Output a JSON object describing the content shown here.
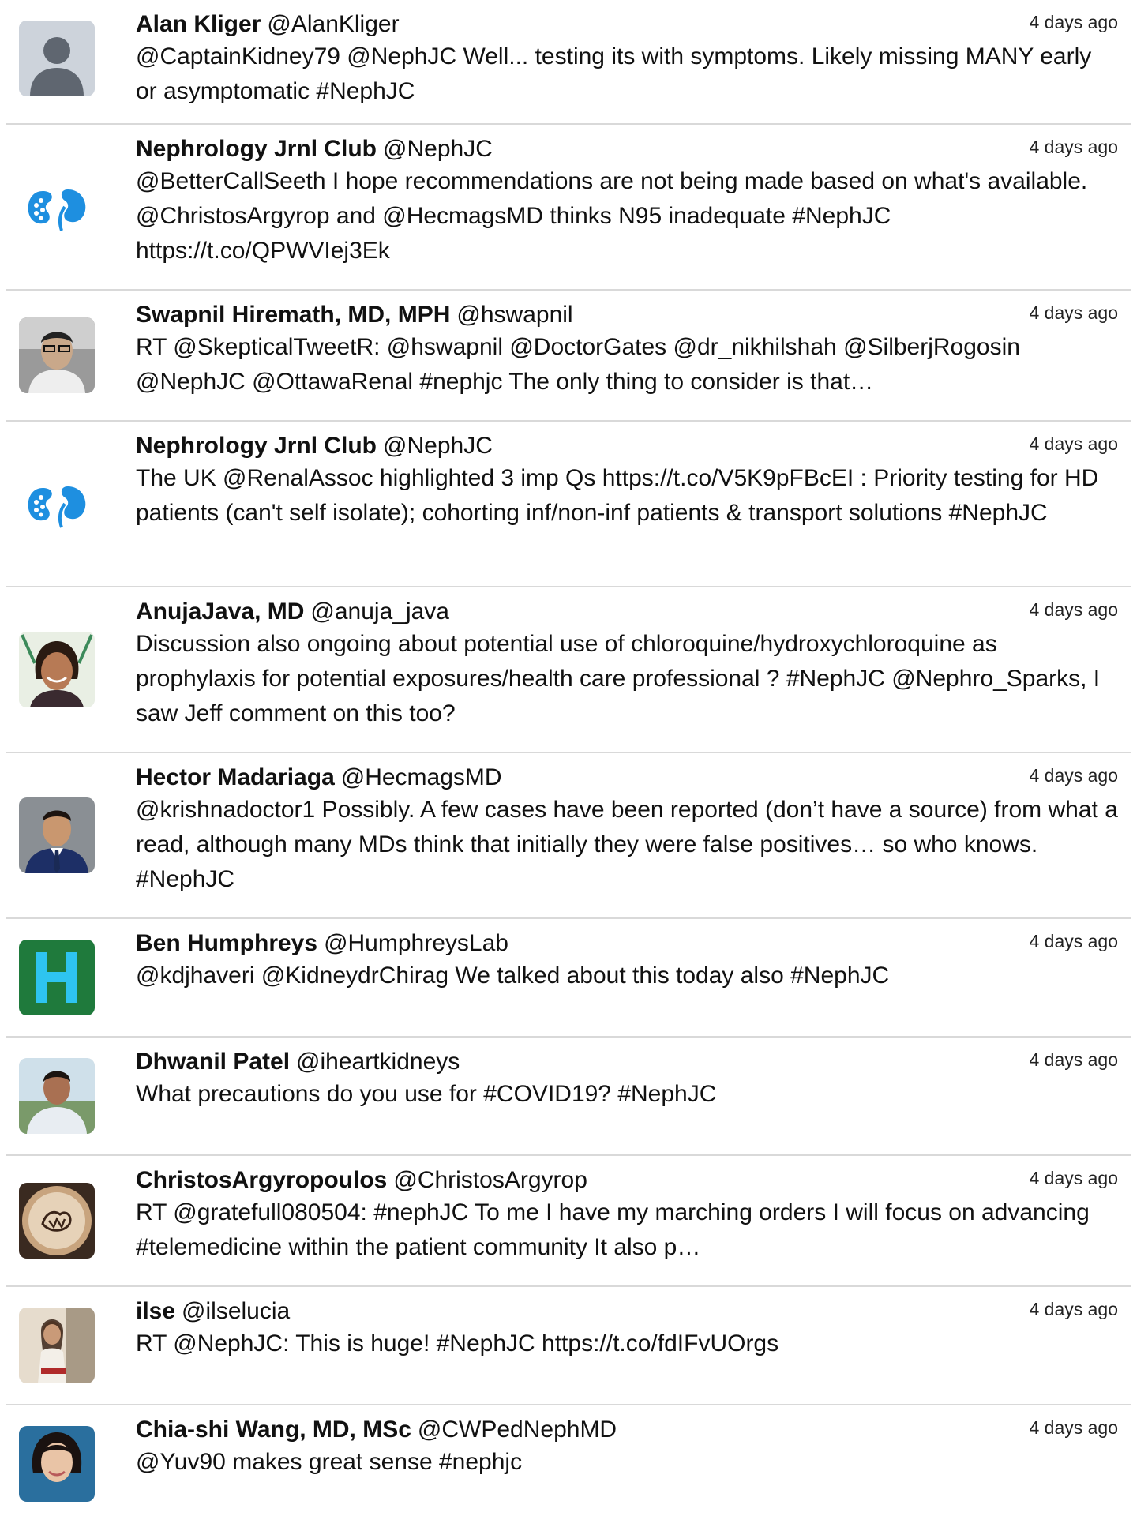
{
  "tweets": [
    {
      "name": "Alan Kliger",
      "handle": "@AlanKliger",
      "time": "4 days ago",
      "text": "@CaptainKidney79 @NephJC Well... testing its with symptoms. Likely missing MANY early or asymptomatic #NephJC",
      "avatar_icon": "default-user-icon"
    },
    {
      "name": "Nephrology Jrnl Club",
      "handle": "@NephJC",
      "time": "4 days ago",
      "text": "@BetterCallSeeth I hope recommendations are not being made based on what's available. @ChristosArgyrop and @HecmagsMD thinks N95 inadequate #NephJC https://t.co/QPWVIej3Ek",
      "avatar_icon": "kidney-logo-icon"
    },
    {
      "name": "Swapnil Hiremath, MD, MPH",
      "handle": "@hswapnil",
      "time": "4 days ago",
      "text": "RT @SkepticalTweetR: @hswapnil @DoctorGates @dr_nikhilshah @SilberjRogosin @NephJC @OttawaRenal #nephjc The only thing to consider is that…",
      "avatar_icon": "profile-photo-icon"
    },
    {
      "name": "Nephrology Jrnl Club",
      "handle": "@NephJC",
      "time": "4 days ago",
      "text": "The UK @RenalAssoc highlighted 3 imp Qs https://t.co/V5K9pFBcEI : Priority testing for HD patients (can't self isolate); cohorting inf/non-inf patients & transport solutions #NephJC",
      "avatar_icon": "kidney-logo-icon"
    },
    {
      "name": "AnujaJava, MD",
      "handle": "@anuja_java",
      "time": "4 days ago",
      "text": "Discussion also ongoing about potential use of chloroquine/hydroxychloroquine as prophylaxis for potential exposures/health care professional ? #NephJC @Nephro_Sparks, I saw Jeff comment on this too?",
      "avatar_icon": "profile-photo-icon"
    },
    {
      "name": "Hector Madariaga",
      "handle": "@HecmagsMD",
      "time": "4 days ago",
      "text": "@krishnadoctor1 Possibly. A few cases have been reported (don’t have a source) from what a read, although many MDs think that initially they were false positives… so who knows. #NephJC",
      "avatar_icon": "profile-photo-icon"
    },
    {
      "name": "Ben Humphreys",
      "handle": "@HumphreysLab",
      "time": "4 days ago",
      "text": "@kdjhaveri @KidneydrChirag We talked about this today also #NephJC",
      "avatar_icon": "letter-h-logo-icon"
    },
    {
      "name": "Dhwanil Patel",
      "handle": "@iheartkidneys",
      "time": "4 days ago",
      "text": "What precautions do you use for #COVID19? #NephJC",
      "avatar_icon": "profile-photo-icon"
    },
    {
      "name": "ChristosArgyropoulos",
      "handle": "@ChristosArgyrop",
      "time": "4 days ago",
      "text": "RT @gratefull080504: #nephJC To me I have my marching orders I will focus on advancing #telemedicine within the patient community It also p…",
      "avatar_icon": "latte-art-icon"
    },
    {
      "name": "ilse",
      "handle": "@ilselucia",
      "time": "4 days ago",
      "text": "RT @NephJC: This is huge! #NephJC https://t.co/fdIFvUOrgs",
      "avatar_icon": "profile-photo-icon"
    },
    {
      "name": "Chia-shi Wang, MD, MSc",
      "handle": "@CWPedNephMD",
      "time": "4 days ago",
      "text": "@Yuv90 makes great sense #nephjc",
      "avatar_icon": "profile-photo-icon"
    }
  ],
  "colors": {
    "divider": "#d9d9d9",
    "kidney_blue": "#1e8fe0",
    "h_logo_green": "#1f7a3c",
    "h_logo_cyan": "#2ec4f0"
  }
}
